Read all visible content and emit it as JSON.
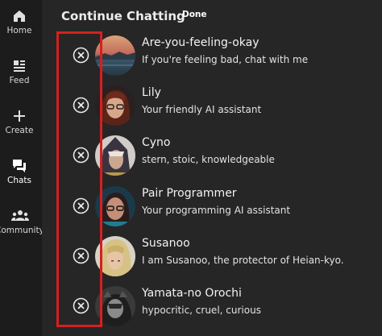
{
  "nav": {
    "items": [
      {
        "label": "Home",
        "icon": "home-icon"
      },
      {
        "label": "Feed",
        "icon": "feed-icon"
      },
      {
        "label": "Create",
        "icon": "plus-icon"
      },
      {
        "label": "Chats",
        "icon": "chat-bubbles-icon"
      },
      {
        "label": "Community",
        "icon": "community-icon"
      }
    ]
  },
  "header": {
    "title": "Continue Chatting",
    "done_label": "Done"
  },
  "chats": [
    {
      "name": "Are-you-feeling-okay",
      "description": "If you're feeling bad, chat with me",
      "avatar": "sunset-landscape-avatar"
    },
    {
      "name": "Lily",
      "description": "Your friendly AI assistant",
      "avatar": "woman-with-glasses-avatar"
    },
    {
      "name": "Cyno",
      "description": "stern, stoic, knowledgeable",
      "avatar": "hooded-character-avatar"
    },
    {
      "name": "Pair Programmer",
      "description": "Your programming AI assistant",
      "avatar": "woman-with-glasses-teal-avatar"
    },
    {
      "name": "Susanoo",
      "description": "I am Susanoo, the protector of Heian-kyo.",
      "avatar": "blond-warrior-avatar"
    },
    {
      "name": "Yamata-no Orochi",
      "description": "hypocritic, cruel, curious",
      "avatar": "dark-creature-avatar"
    }
  ],
  "colors": {
    "background": "#262626",
    "sidebar": "#1c1c1c",
    "highlight": "#d42020"
  }
}
